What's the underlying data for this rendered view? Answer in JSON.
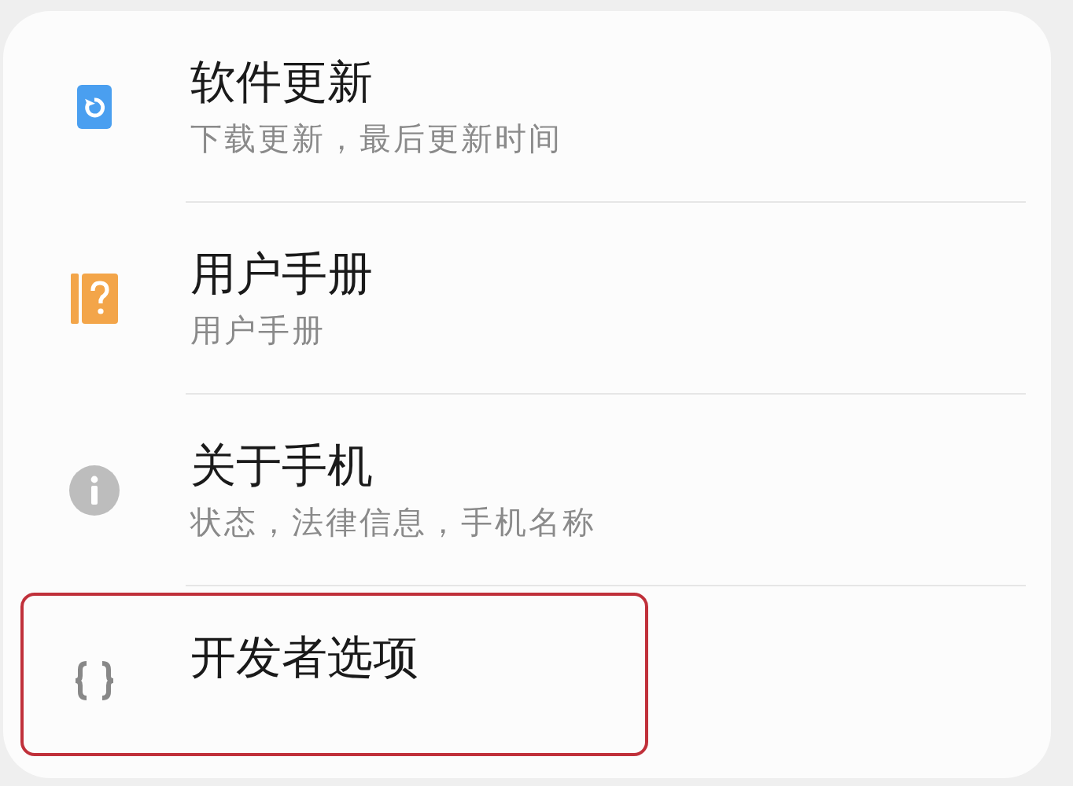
{
  "settings_items": [
    {
      "kind": "update",
      "title": "软件更新",
      "subtitle": "下载更新，最后更新时间",
      "highlighted": false
    },
    {
      "kind": "manual",
      "title": "用户手册",
      "subtitle": "用户手册",
      "highlighted": false
    },
    {
      "kind": "info",
      "title": "关于手机",
      "subtitle": "状态，法律信息，手机名称",
      "highlighted": false
    },
    {
      "kind": "developer",
      "title": "开发者选项",
      "highlighted": true
    }
  ]
}
